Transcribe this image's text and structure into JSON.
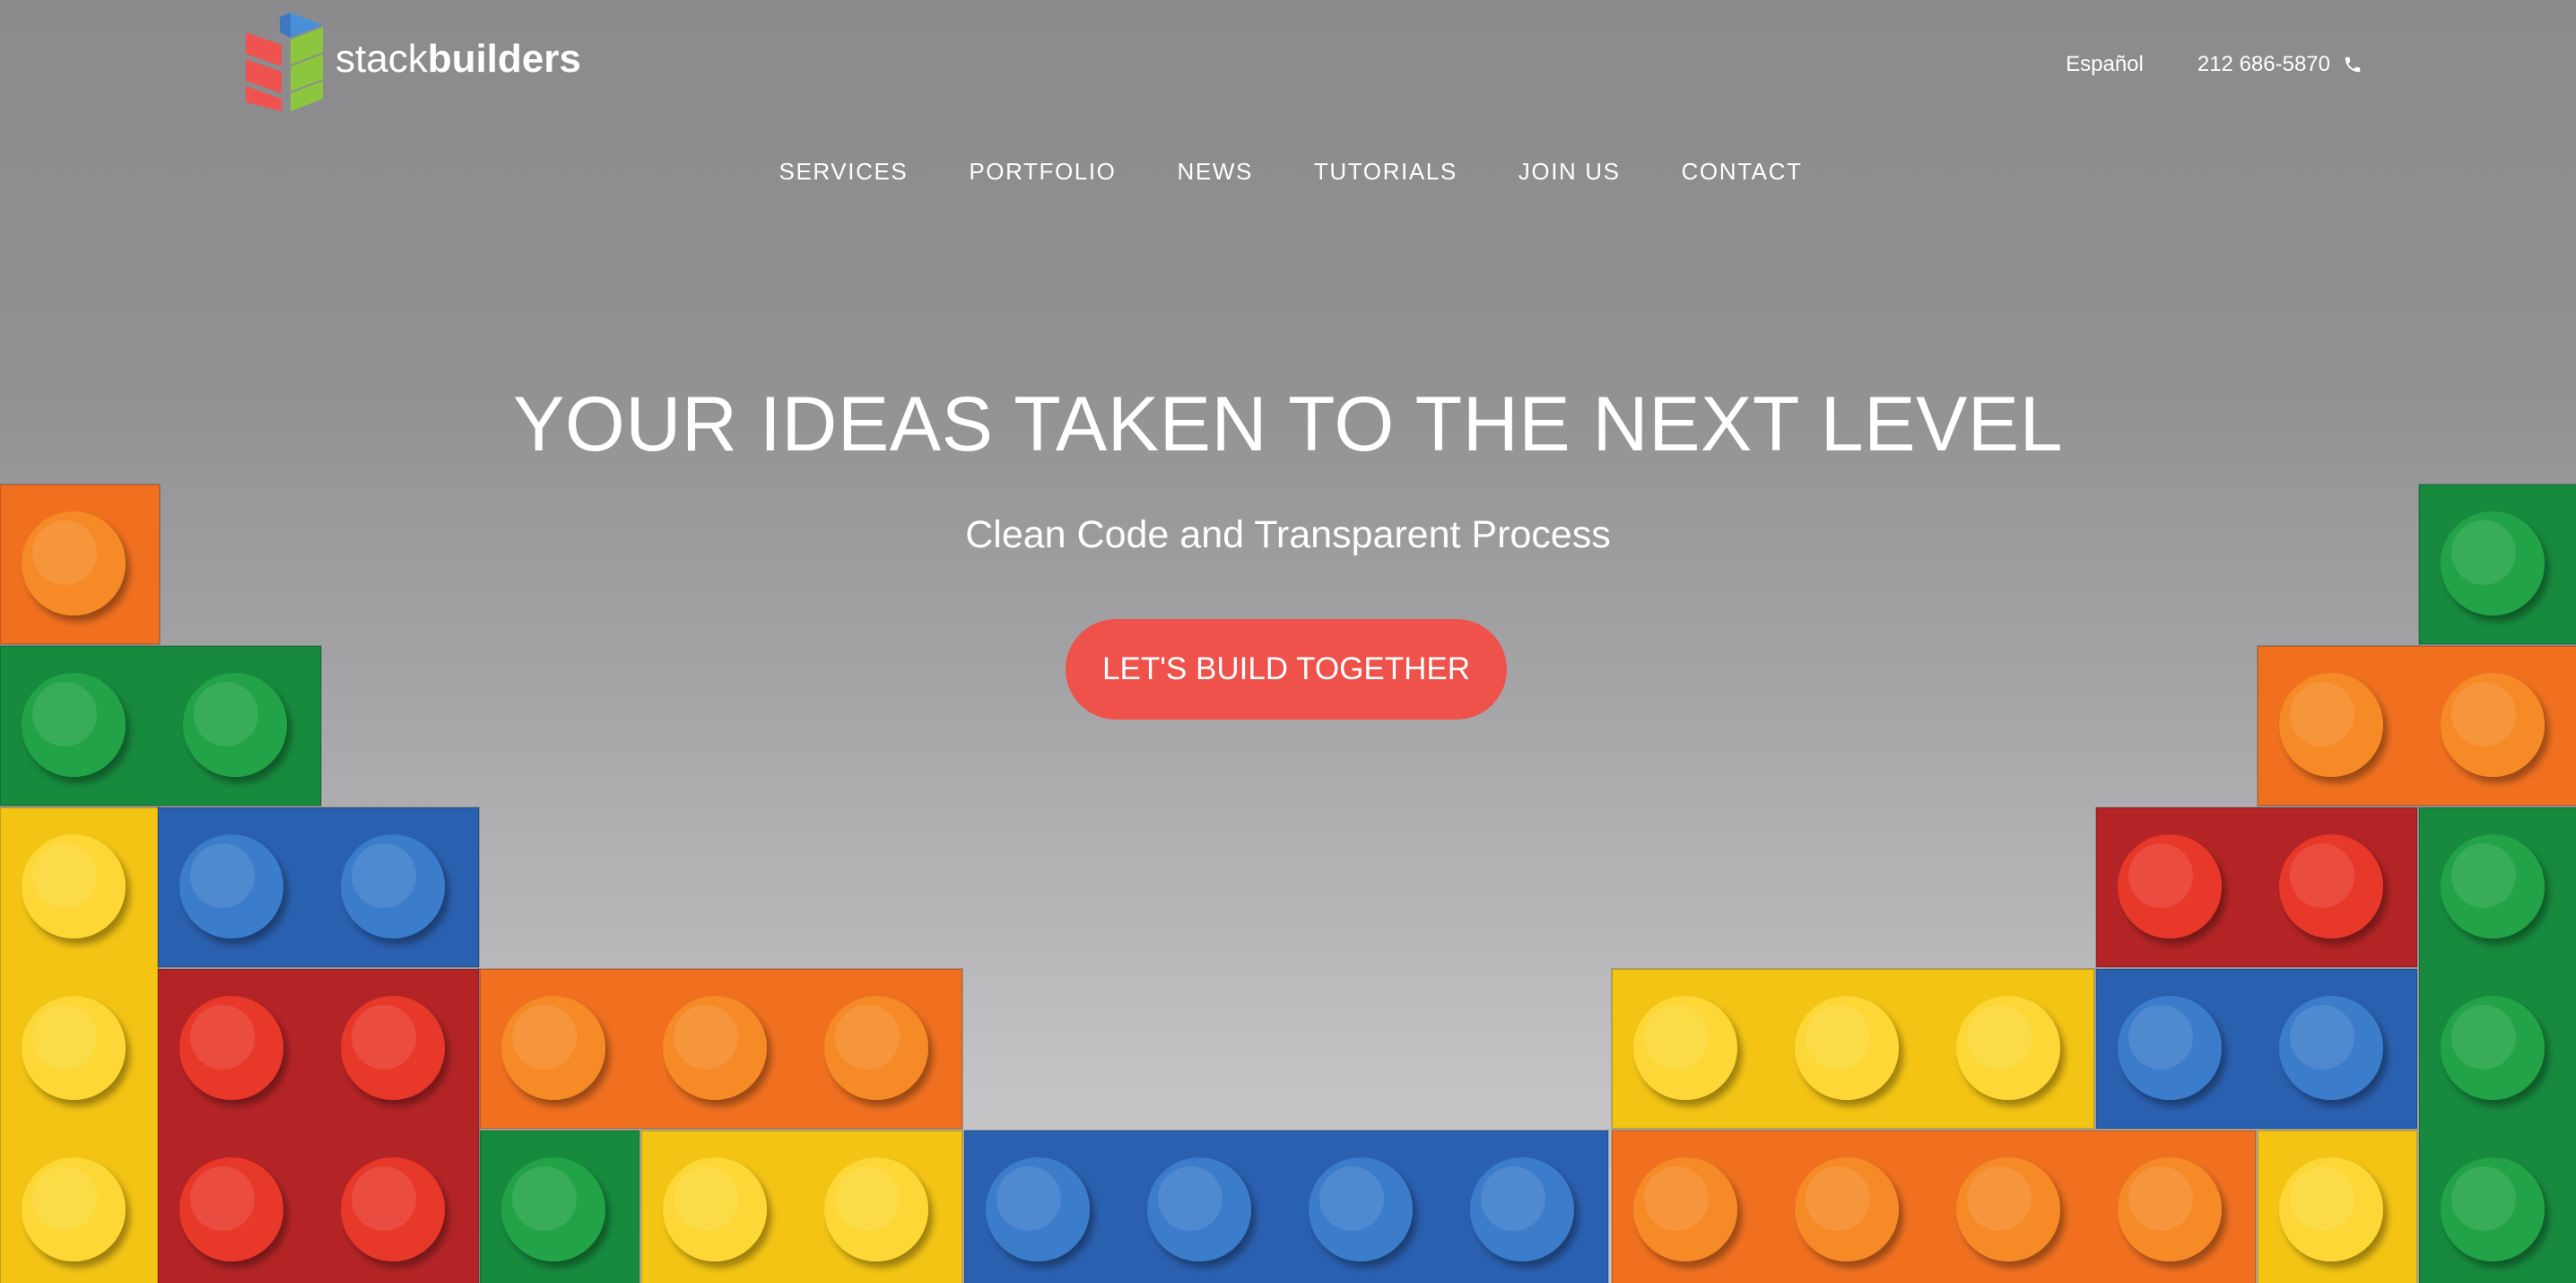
{
  "brand": {
    "name_light": "stack",
    "name_bold": "builders",
    "logo_colors": [
      "#4a90d9",
      "#8cc63f",
      "#ef5350"
    ]
  },
  "header": {
    "language_link": "Español",
    "phone": "212 686-5870",
    "phone_icon": "phone-icon"
  },
  "nav": {
    "items": [
      {
        "label": "SERVICES"
      },
      {
        "label": "PORTFOLIO"
      },
      {
        "label": "NEWS"
      },
      {
        "label": "TUTORIALS"
      },
      {
        "label": "JOIN US"
      },
      {
        "label": "CONTACT"
      }
    ]
  },
  "hero": {
    "title": "YOUR IDEAS TAKEN TO THE NEXT LEVEL",
    "subtitle": "Clean Code and Transparent Process",
    "cta_label": "LET'S BUILD TOGETHER",
    "cta_color": "#ef514b"
  },
  "bricks": {
    "colors": {
      "O": [
        "#f07020",
        "#f58a26"
      ],
      "G": [
        "#178a3e",
        "#22a346"
      ],
      "Y": [
        "#f3c414",
        "#fcd735"
      ],
      "B": [
        "#2a60b0",
        "#3a7ccb"
      ],
      "R": [
        "#b42426",
        "#e8372a"
      ]
    }
  }
}
